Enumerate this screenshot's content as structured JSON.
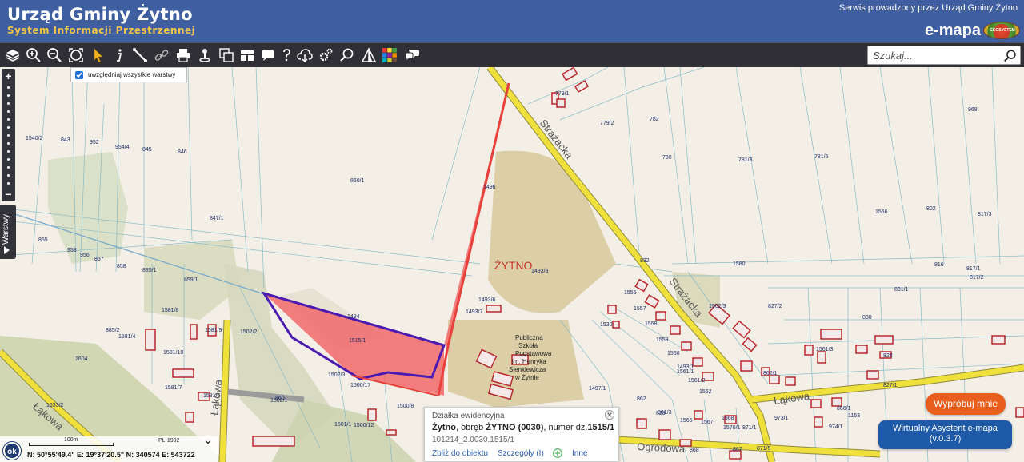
{
  "header": {
    "title": "Urząd Gminy Żytno",
    "subtitle": "System Informacji Przestrzennej",
    "service_text": "Serwis prowadzony przez Urząd Gminy Żytno",
    "product_name": "e-mapa",
    "logo_text": "GEOSYSTEM"
  },
  "toolbar": {
    "tools": [
      "layers-icon",
      "zoom-in-icon",
      "zoom-out-icon",
      "zoom-extent-icon",
      "pointer-icon",
      "info-icon",
      "measure-icon",
      "link-icon",
      "print-icon",
      "location-icon",
      "copy-icon",
      "layout-icon",
      "comment-icon",
      "help-icon",
      "cloud-icon",
      "settings-icon",
      "search-tool-icon",
      "terrain-icon",
      "color-grid-icon",
      "chat-icon"
    ],
    "search_placeholder": "Szukaj..."
  },
  "layer_option": {
    "label": "uwzględniaj wszystkie warstwy",
    "checked": true
  },
  "layers_tab": {
    "label": "Warstwy"
  },
  "map": {
    "place_label": "ŻYTNO",
    "streets": [
      "Strażacka",
      "Strażacka",
      "Łąkowa",
      "Łąkowa",
      "Ogrodowa",
      "Łąkowa"
    ],
    "parcels": [
      "1540/2",
      "843",
      "952",
      "954/4",
      "845",
      "846",
      "860/1",
      "847/1",
      "855",
      "958",
      "956",
      "857",
      "858",
      "885/1",
      "859/1",
      "1581/8",
      "885/2",
      "1581/4",
      "1581/9",
      "1502/2",
      "1581/10",
      "1604",
      "1581/7",
      "1581/6",
      "1502/1",
      "1633/2",
      "1501/1",
      "1500/12",
      "1500/17",
      "1500/8",
      "1502/3",
      "1494",
      "1515/1",
      "1496",
      "1493/8",
      "1493/6",
      "1493/7",
      "1497/1",
      "779/1",
      "779/2",
      "782",
      "968",
      "780",
      "781/3",
      "781/5",
      "1566",
      "802",
      "817/3",
      "832",
      "1580",
      "816",
      "817/1",
      "817/2",
      "831/1",
      "827/2",
      "830",
      "1556",
      "1557",
      "1558",
      "1559",
      "1560",
      "1561/1",
      "1561/2",
      "1562",
      "1562/3",
      "1530",
      "1493/1",
      "1561/3",
      "828",
      "829",
      "862",
      "861/3",
      "862/1",
      "827/1",
      "1163",
      "974/1",
      "973/1",
      "866/1",
      "1565",
      "1567",
      "1568",
      "1570/1",
      "871/1",
      "871/5",
      "867",
      "868",
      "860",
      "1502"
    ],
    "colors": {
      "background": "#f3efe6",
      "selected_parcel": "#f06a6a",
      "selected_outline": "#4b1ab0",
      "road": "#f0e03c",
      "building": "#b8282d"
    }
  },
  "popup": {
    "title": "Działka ewidencyjna",
    "place": "Żytno",
    "precinct_text": ", obręb ",
    "precinct": "ŻYTNO (0030)",
    "number_text": ", numer dz.",
    "number": "1515/1",
    "identifier": "101214_2.0030.1515/1",
    "zoom_link": "Zbliż do obiektu",
    "details_link": "Szczegóły (I)",
    "other_link": "Inne"
  },
  "coords_panel": {
    "ok_label": "ok",
    "scale_label": "100m",
    "crs": "PL-1992",
    "coordinates": "N: 50°55'49.4\"  E: 19°37'20.5\"  N: 340574  E: 543722"
  },
  "assistant": {
    "try_label": "Wypróbuj mnie",
    "assistant_label": "Wirtualny Asystent e-mapa",
    "version": "(v.0.3.7)"
  }
}
